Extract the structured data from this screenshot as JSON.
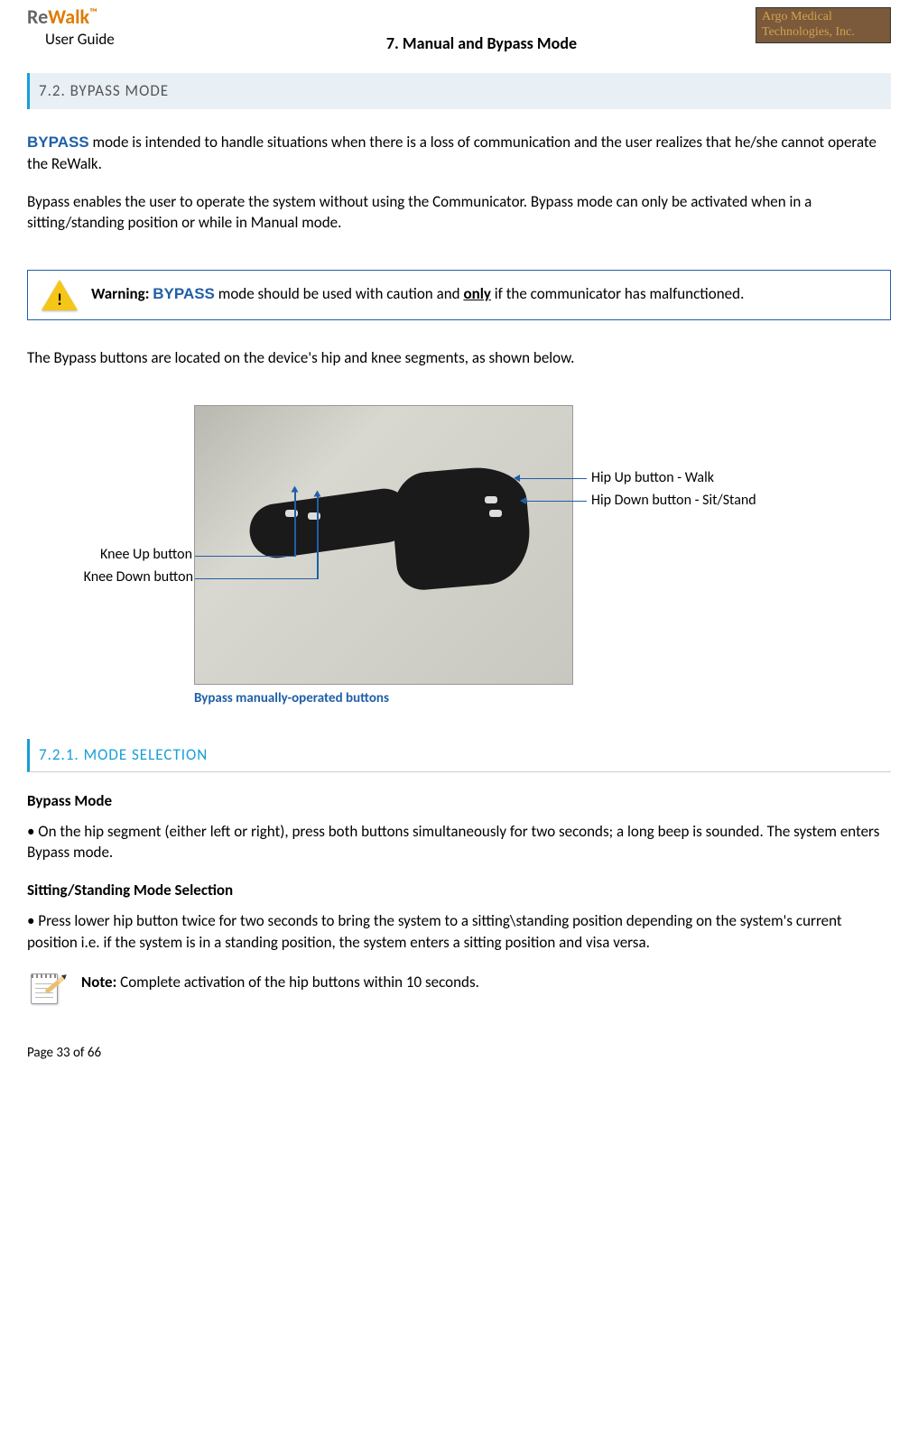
{
  "header": {
    "logo_re": "Re",
    "logo_walk": "Walk",
    "logo_tm": "™",
    "user_guide": "User Guide",
    "chapter_title": "7. Manual and Bypass Mode",
    "company_line1": "Argo Medical",
    "company_line2": "Technologies, Inc."
  },
  "section_7_2": "7.2. BYPASS MODE",
  "para1_bold": "BYPASS",
  "para1_rest": " mode is intended to handle situations when there is a loss of communication and the user realizes that he/she cannot operate the ReWalk.",
  "para2": "Bypass enables the user to operate the system without using the Communicator. Bypass mode can only be activated when in a sitting/standing position or while in Manual mode.",
  "warning": {
    "label": "Warning: ",
    "bypass": "BYPASS",
    "mid": " mode should be used with caution and ",
    "only": "only",
    "end": " if the communicator has malfunctioned."
  },
  "para3": "The Bypass buttons are located on the device's hip and knee segments, as shown below.",
  "figure": {
    "knee_up": "Knee Up button",
    "knee_down": "Knee Down button",
    "hip_up": "Hip Up button - Walk",
    "hip_down": "Hip Down button - Sit/Stand",
    "caption": "Bypass manually-operated buttons"
  },
  "section_7_2_1": "7.2.1. MODE SELECTION",
  "mode_selection": {
    "bypass_head": "Bypass Mode",
    "bypass_text": "• On the hip segment (either left or right), press both buttons simultaneously for two seconds; a long beep is sounded. The system enters Bypass mode.",
    "sitstand_head": "Sitting/Standing Mode Selection",
    "sitstand_text": "•   Press lower hip button twice for two seconds to bring the system to a sitting\\standing position depending on the system's current position i.e. if the system is in a standing position, the system enters a sitting position and visa versa."
  },
  "note": {
    "label": "Note: ",
    "text": "Complete activation of the hip buttons within 10 seconds."
  },
  "footer": "Page 33 of 66"
}
